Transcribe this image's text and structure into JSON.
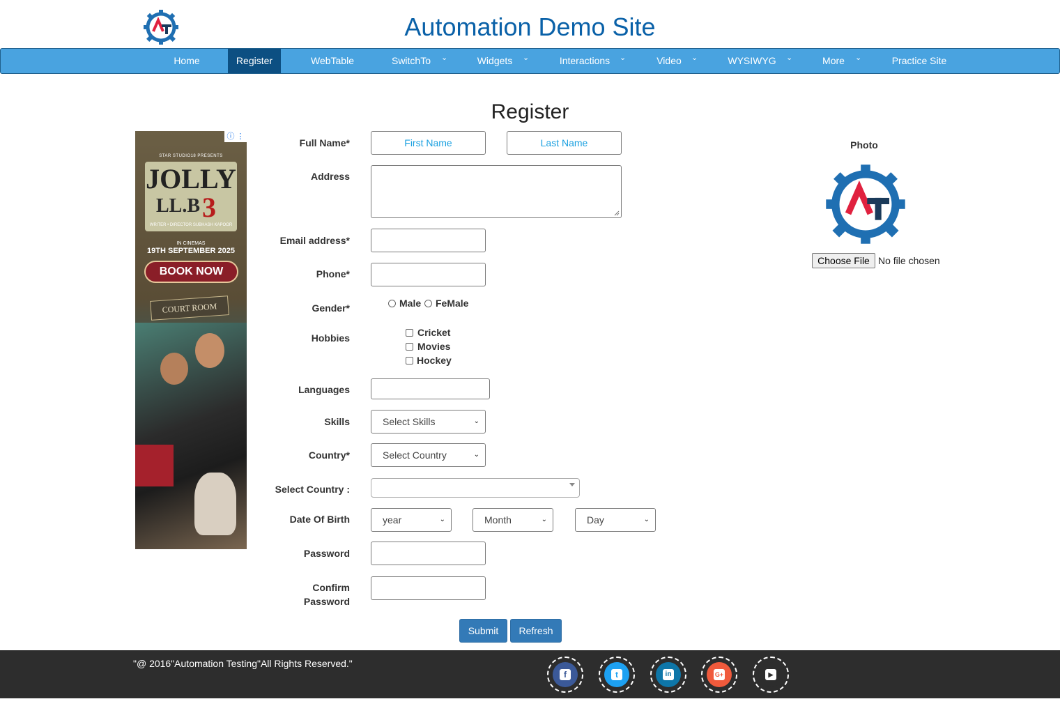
{
  "header": {
    "site_title": "Automation Demo Site",
    "logo_icon": "automation-gear-logo-icon"
  },
  "nav": {
    "items": [
      {
        "label": "Home",
        "dropdown": false
      },
      {
        "label": "Register",
        "dropdown": false,
        "active": true
      },
      {
        "label": "WebTable",
        "dropdown": false
      },
      {
        "label": "SwitchTo",
        "dropdown": true
      },
      {
        "label": "Widgets",
        "dropdown": true
      },
      {
        "label": "Interactions",
        "dropdown": true
      },
      {
        "label": "Video",
        "dropdown": true
      },
      {
        "label": "WYSIWYG",
        "dropdown": true
      },
      {
        "label": "More",
        "dropdown": true
      },
      {
        "label": "Practice Site",
        "dropdown": false
      }
    ],
    "chevron": "⌄"
  },
  "page": {
    "heading": "Register"
  },
  "ad": {
    "studio": "STAR STUDIO18 PRESENTS",
    "title": "JOLLY",
    "subtitle": "LL.B",
    "number": "3",
    "credit": "WRITER • DIRECTOR SUBHASH KAPOOR",
    "in_cinemas": "IN CINEMAS",
    "date": "19TH SEPTEMBER 2025",
    "cta": "BOOK NOW",
    "sign": "COURT ROOM",
    "badge": "ⓘ ⋮"
  },
  "form": {
    "full_name_label": "Full Name*",
    "first_name_placeholder": "First Name",
    "last_name_placeholder": "Last Name",
    "address_label": "Address",
    "email_label": "Email address*",
    "phone_label": "Phone*",
    "gender_label": "Gender*",
    "gender_options": [
      "Male",
      "FeMale"
    ],
    "hobbies_label": "Hobbies",
    "hobbies_options": [
      "Cricket",
      "Movies",
      "Hockey"
    ],
    "languages_label": "Languages",
    "skills_label": "Skills",
    "skills_value": "Select Skills",
    "country_label": "Country*",
    "country_value": "Select Country",
    "select_country_label": "Select Country :",
    "dob_label": "Date Of Birth",
    "dob_year": "year",
    "dob_month": "Month",
    "dob_day": "Day",
    "password_label": "Password",
    "confirm_password_label_1": "Confirm",
    "confirm_password_label_2": "Password",
    "submit_label": "Submit",
    "refresh_label": "Refresh",
    "select_arrow": "⌄"
  },
  "photo": {
    "label": "Photo",
    "choose_file": "Choose File",
    "no_file": "No file chosen"
  },
  "footer": {
    "copyright": "\"@ 2016\"Automation Testing\"All Rights Reserved.\"",
    "social": [
      {
        "name": "facebook-icon",
        "color": "#3b5998",
        "glyph": "f"
      },
      {
        "name": "twitter-icon",
        "color": "#1da1f2",
        "glyph": "t"
      },
      {
        "name": "linkedin-icon",
        "color": "#0e76a8",
        "glyph": "in"
      },
      {
        "name": "google-plus-icon",
        "color": "#f05a3c",
        "glyph": "G+"
      },
      {
        "name": "youtube-icon",
        "color": "#2d2d2d",
        "glyph": "▶"
      }
    ]
  },
  "colors": {
    "nav_bg": "#49a3e0",
    "nav_active": "#0c4f82",
    "title": "#0a61a8",
    "button": "#337ab7",
    "footer_bg": "#2d2d2d"
  }
}
